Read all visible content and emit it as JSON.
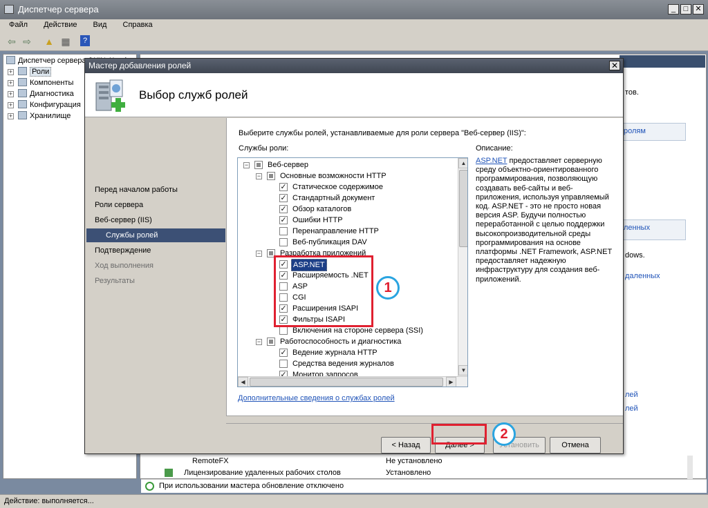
{
  "main_window": {
    "title": "Диспетчер сервера",
    "menu": [
      "Файл",
      "Действие",
      "Вид",
      "Справка"
    ],
    "tree": [
      {
        "label": "Диспетчер сервера (WIN-1L... )"
      },
      {
        "label": "Роли"
      },
      {
        "label": "Компоненты"
      },
      {
        "label": "Диагностика"
      },
      {
        "label": "Конфигурация"
      },
      {
        "label": "Хранилище"
      }
    ],
    "right_fragments": {
      "t1": "тов.",
      "t2": "ролям",
      "t3": "ленных",
      "t4": "dows.",
      "t5": "даленных",
      "t6": "лей",
      "t7": "лей"
    },
    "bottom_rows": [
      {
        "name": "RemoteFX",
        "status": "Не установлено"
      },
      {
        "name": "Лицензирование удаленных рабочих столов",
        "status": "Установлено"
      }
    ],
    "info_strip": "При использовании мастера обновление отключено",
    "status_bar": "Действие: выполняется..."
  },
  "wizard": {
    "title": "Мастер добавления ролей",
    "header_title": "Выбор служб ролей",
    "nav": [
      {
        "label": "Перед началом работы",
        "state": "normal"
      },
      {
        "label": "Роли сервера",
        "state": "normal"
      },
      {
        "label": "Веб-сервер (IIS)",
        "state": "normal"
      },
      {
        "label": "Службы ролей",
        "state": "current"
      },
      {
        "label": "Подтверждение",
        "state": "normal"
      },
      {
        "label": "Ход выполнения",
        "state": "dim"
      },
      {
        "label": "Результаты",
        "state": "dim"
      }
    ],
    "instruction": "Выберите службы ролей, устанавливаемые для роли сервера \"Веб-сервер (IIS)\":",
    "services_label": "Службы роли:",
    "description_label": "Описание:",
    "description_link": "ASP.NET",
    "description_text": " предоставляет серверную среду объектно-ориентированного программирования, позволяющую создавать веб-сайты и веб-приложения, используя управляемый код. ASP.NET - это не просто новая версия ASP. Будучи полностью переработанной с целью поддержки высокопроизводительной среды программирования на основе платформы .NET Framework, ASP.NET предоставляет надежную инфраструктуру для создания веб-приложений.",
    "services": [
      {
        "label": "Веб-сервер",
        "state": "partial",
        "level": 0,
        "expander": "minus"
      },
      {
        "label": "Основные возможности HTTP",
        "state": "partial",
        "level": 1,
        "expander": "minus"
      },
      {
        "label": "Статическое содержимое",
        "state": "checked",
        "level": 2
      },
      {
        "label": "Стандартный документ",
        "state": "checked",
        "level": 2
      },
      {
        "label": "Обзор каталогов",
        "state": "checked",
        "level": 2
      },
      {
        "label": "Ошибки HTTP",
        "state": "checked",
        "level": 2
      },
      {
        "label": "Перенаправление HTTP",
        "state": "unchecked",
        "level": 2
      },
      {
        "label": "Веб-публикация DAV",
        "state": "unchecked",
        "level": 2
      },
      {
        "label": "Разработка приложений",
        "state": "partial",
        "level": 1,
        "expander": "minus"
      },
      {
        "label": "ASP.NET",
        "state": "checked",
        "level": 2,
        "selected": true
      },
      {
        "label": "Расширяемость .NET",
        "state": "checked",
        "level": 2
      },
      {
        "label": "ASP",
        "state": "unchecked",
        "level": 2
      },
      {
        "label": "CGI",
        "state": "unchecked",
        "level": 2
      },
      {
        "label": "Расширения ISAPI",
        "state": "checked",
        "level": 2
      },
      {
        "label": "Фильтры ISAPI",
        "state": "checked",
        "level": 2
      },
      {
        "label": "Включения на стороне сервера (SSI)",
        "state": "unchecked",
        "level": 2
      },
      {
        "label": "Работоспособность и диагностика",
        "state": "partial",
        "level": 1,
        "expander": "minus"
      },
      {
        "label": "Ведение журнала HTTP",
        "state": "checked",
        "level": 2
      },
      {
        "label": "Средства ведения журналов",
        "state": "unchecked",
        "level": 2
      },
      {
        "label": "Монитор запросов",
        "state": "checked",
        "level": 2
      }
    ],
    "more_info_link": "Дополнительные сведения о службах ролей",
    "buttons": {
      "back": "< Назад",
      "next": "Далее >",
      "install": "Установить",
      "cancel": "Отмена"
    },
    "callouts": [
      "1",
      "2"
    ]
  },
  "colors": {
    "highlight_box": "#e02030",
    "callout_border": "#2aa4e0",
    "selection": "#1c3f87",
    "nav_current": "#3c5075",
    "link": "#1f53b8"
  }
}
